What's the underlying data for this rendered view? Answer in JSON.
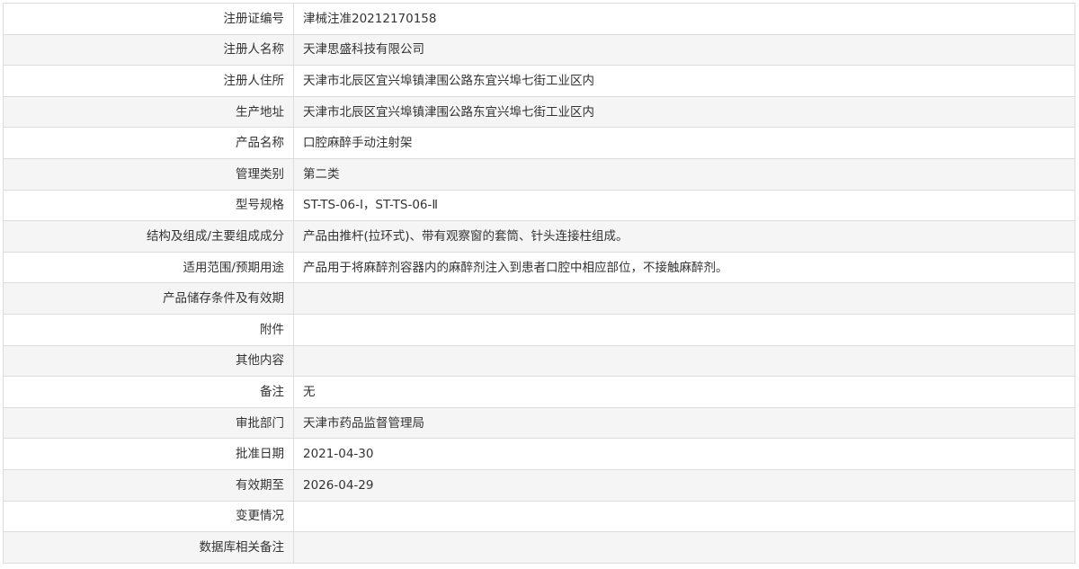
{
  "rows": [
    {
      "label": "注册证编号",
      "value": "津械注准20212170158"
    },
    {
      "label": "注册人名称",
      "value": "天津思盛科技有限公司"
    },
    {
      "label": "注册人住所",
      "value": "天津市北辰区宜兴埠镇津围公路东宜兴埠七街工业区内"
    },
    {
      "label": "生产地址",
      "value": "天津市北辰区宜兴埠镇津围公路东宜兴埠七街工业区内"
    },
    {
      "label": "产品名称",
      "value": "口腔麻醉手动注射架"
    },
    {
      "label": "管理类别",
      "value": "第二类"
    },
    {
      "label": "型号规格",
      "value": "ST-TS-06-Ⅰ，ST-TS-06-Ⅱ"
    },
    {
      "label": "结构及组成/主要组成成分",
      "value": "产品由推杆(拉环式)、带有观察窗的套筒、针头连接柱组成。"
    },
    {
      "label": "适用范围/预期用途",
      "value": "产品用于将麻醉剂容器内的麻醉剂注入到患者口腔中相应部位，不接触麻醉剂。"
    },
    {
      "label": "产品储存条件及有效期",
      "value": ""
    },
    {
      "label": "附件",
      "value": ""
    },
    {
      "label": "其他内容",
      "value": ""
    },
    {
      "label": "备注",
      "value": "无"
    },
    {
      "label": "审批部门",
      "value": "天津市药品监督管理局"
    },
    {
      "label": "批准日期",
      "value": "2021-04-30"
    },
    {
      "label": "有效期至",
      "value": "2026-04-29"
    },
    {
      "label": "变更情况",
      "value": ""
    },
    {
      "label": "数据库相关备注",
      "value": ""
    }
  ]
}
